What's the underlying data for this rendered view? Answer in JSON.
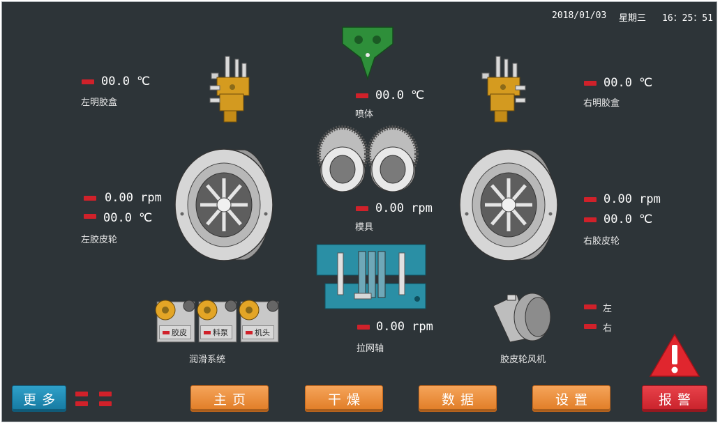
{
  "header": {
    "date": "2018/01/03",
    "weekday": "星期三",
    "time": "16：25：51"
  },
  "left_glue_box": {
    "value": "00.0 ℃",
    "label": "左明胶盒"
  },
  "nozzle": {
    "value": "00.0 ℃",
    "label": "喷体"
  },
  "right_glue_box": {
    "value": "00.0 ℃",
    "label": "右明胶盒"
  },
  "left_wheel": {
    "speed": "0.00 rpm",
    "temp": "00.0 ℃",
    "label": "左胶皮轮"
  },
  "mold": {
    "speed": "0.00 rpm",
    "label": "模具"
  },
  "right_wheel": {
    "speed": "0.00 rpm",
    "temp": "00.0 ℃",
    "label": "右胶皮轮"
  },
  "net_shaft": {
    "speed": "0.00 rpm",
    "label": "拉网轴"
  },
  "lubrication": {
    "label": "润滑系统",
    "tags": [
      "胶皮",
      "料泵",
      "机头"
    ]
  },
  "wheel_fan": {
    "label": "胶皮轮风机",
    "left": "左",
    "right": "右"
  },
  "nav": {
    "more": "更多",
    "home": "主页",
    "dry": "干燥",
    "data": "数据",
    "settings": "设置",
    "alarm": "报警"
  },
  "colors": {
    "background": "#2d3438",
    "indicator": "#d0212a",
    "orange_button": "#e8893a",
    "blue_button": "#1a86b0",
    "alarm_button": "#d8252f"
  }
}
